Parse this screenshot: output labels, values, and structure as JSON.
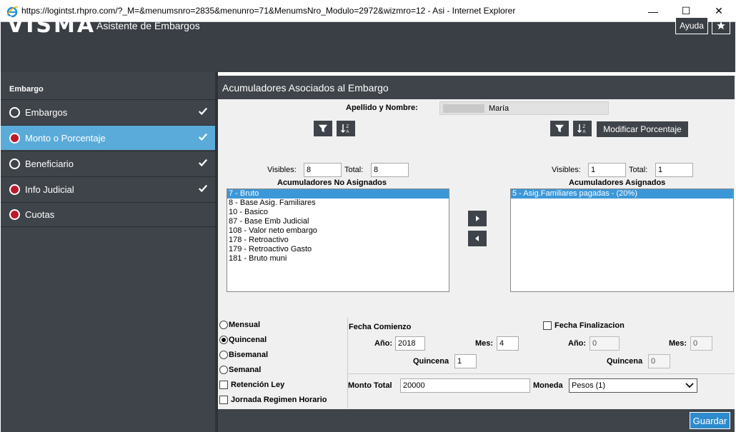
{
  "window": {
    "title": "https://logintst.rhpro.com/?_M=&menumsnro=2835&menunro=71&MenumsNro_Modulo=2972&wizmro=12 - Asi - Internet Explorer",
    "minimize": "—",
    "maximize": "☐",
    "close": "✕"
  },
  "header": {
    "logo": "VISMA",
    "app_title": "Asistente de Embargos",
    "help_label": "Ayuda"
  },
  "sidebar": {
    "heading": "Embargo",
    "items": [
      {
        "label": "Embargos",
        "radio": "empty",
        "done": true,
        "active": false
      },
      {
        "label": "Monto o Porcentaje",
        "radio": "red",
        "done": true,
        "active": true
      },
      {
        "label": "Beneficiario",
        "radio": "empty",
        "done": true,
        "active": false
      },
      {
        "label": "Info Judicial",
        "radio": "red",
        "done": true,
        "active": false
      },
      {
        "label": "Cuotas",
        "radio": "red",
        "done": false,
        "active": false
      }
    ]
  },
  "main": {
    "title": "Acumuladores Asociados al Embargo",
    "name_label": "Apellido y Nombre:",
    "name_value": "María",
    "modify_label": "Modificar Porcentaje",
    "left": {
      "visibles_label": "Visibles:",
      "visibles_value": "8",
      "total_label": "Total:",
      "total_value": "8",
      "list_title": "Acumuladores No Asignados",
      "items": [
        "7 - Bruto",
        "8 - Base Asig. Familiares",
        "10 - Basico",
        "87 - Base Emb Judicial",
        "108 - Valor neto embargo",
        "178 - Retroactivo",
        "179 - Retroactivo Gasto",
        "181 - Bruto muni"
      ]
    },
    "right": {
      "visibles_label": "Visibles:",
      "visibles_value": "1",
      "total_label": "Total:",
      "total_value": "1",
      "list_title": "Acumuladores Asignados",
      "items": [
        "5 - Asig.Familiares pagadas - (20%)"
      ]
    },
    "frequency": {
      "options": [
        "Mensual",
        "Quincenal",
        "Bisemanal",
        "Semanal"
      ],
      "selected": "Quincenal"
    },
    "checks": {
      "retencion": "Retención Ley",
      "jornada": "Jornada Regimen Horario"
    },
    "start": {
      "title": "Fecha Comienzo",
      "year_label": "Año:",
      "year_value": "2018",
      "month_label": "Mes:",
      "month_value": "4",
      "quincena_label": "Quincena",
      "quincena_value": "1"
    },
    "end": {
      "title": "Fecha Finalizacion",
      "year_label": "Año:",
      "year_value": "0",
      "month_label": "Mes:",
      "month_value": "0",
      "quincena_label": "Quincena",
      "quincena_value": "0"
    },
    "amount_label": "Monto Total",
    "amount_value": "20000",
    "currency_label": "Moneda",
    "currency_value": "Pesos (1)",
    "save_label": "Guardar"
  },
  "colors": {
    "dark": "#3f444a",
    "accent": "#5aabd9",
    "radio_red": "#c0182a",
    "save": "#2d8bcd"
  }
}
